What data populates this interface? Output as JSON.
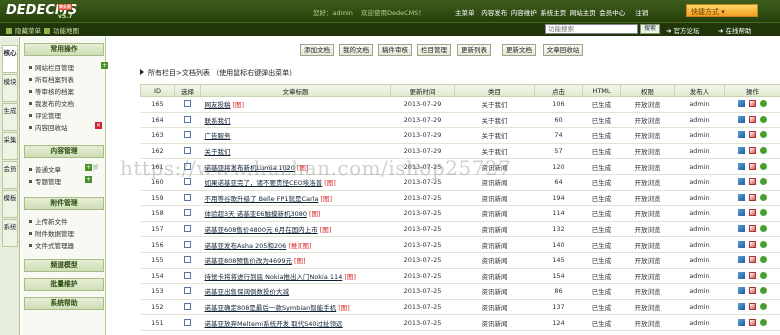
{
  "header": {
    "logo_text": "DEDECMS",
    "logo_badge": "商业版",
    "version": "v5.7",
    "welcome": [
      "您好：admin",
      "欢迎使用DedeCMS！"
    ],
    "nav": [
      "主菜单",
      "内容发布",
      "内容维护",
      "系统主页",
      "网站主页",
      "会员中心",
      "注销"
    ],
    "quick_button": "快捷方式"
  },
  "subbar": {
    "hide_menu": "隐藏菜单",
    "site_map": "功能地图",
    "search_placeholder": "功能搜索",
    "search_button": "搜索",
    "official_forum": "官方论坛",
    "help": "在线帮助"
  },
  "vtabs": [
    "核心",
    "模块",
    "生成",
    "采集",
    "会员",
    "模板",
    "系统"
  ],
  "sidebar": {
    "sections": [
      {
        "title": "常用操作",
        "items": [
          "网站栏目管理",
          "所有档案列表",
          "等审核的档案",
          "我发布的文档",
          "评论管理",
          "内容回收站"
        ]
      },
      {
        "title": "内容管理",
        "items": [
          "普通文章",
          "专题管理"
        ]
      },
      {
        "title": "附件管理",
        "items": [
          "上传新文件",
          "附件数据管理",
          "文件式管理器"
        ]
      },
      {
        "title": "频道模型",
        "items": []
      },
      {
        "title": "批量维护",
        "items": []
      },
      {
        "title": "系统帮助",
        "items": []
      }
    ],
    "plus_sign": "+",
    "mini_label": "部"
  },
  "toolbar": [
    "添加文档",
    "我的文档",
    "稿件审核",
    "栏目管理",
    "更新列表",
    "更新文档",
    "文章回收站"
  ],
  "breadcrumb": "所有栏目>文档列表  （使用鼠标右键弹出菜单）",
  "table": {
    "headers": [
      "ID",
      "选择",
      "文章标题",
      "更新时间",
      "类目",
      "点击",
      "HTML",
      "权限",
      "发布人",
      "操作"
    ],
    "rows": [
      {
        "id": "165",
        "title": "网友投稿",
        "flag": "[图]",
        "date": "2013-07-29",
        "category": "关于我们",
        "clicks": "106",
        "html": "已生成",
        "perm": "开放浏览",
        "author": "admin"
      },
      {
        "id": "164",
        "title": "联系我们",
        "flag": "",
        "date": "2013-07-29",
        "category": "关于我们",
        "clicks": "60",
        "html": "已生成",
        "perm": "开放浏览",
        "author": "admin"
      },
      {
        "id": "163",
        "title": "广告服务",
        "flag": "",
        "date": "2013-07-29",
        "category": "关于我们",
        "clicks": "74",
        "html": "已生成",
        "perm": "开放浏览",
        "author": "admin"
      },
      {
        "id": "162",
        "title": "关于我们",
        "flag": "",
        "date": "2013-07-29",
        "category": "关于我们",
        "clicks": "57",
        "html": "已生成",
        "perm": "开放浏览",
        "author": "admin"
      },
      {
        "id": "161",
        "title": "诺基亚将发布新机Lumia 1020",
        "flag": "[图]",
        "date": "2013-07-25",
        "category": "资讯新闻",
        "clicks": "120",
        "html": "已生成",
        "perm": "开放浏览",
        "author": "admin"
      },
      {
        "id": "160",
        "title": "如果诺基亚完了，诸不要责怪CEO埃洛普",
        "flag": "[图]",
        "date": "2013-07-25",
        "category": "资讯新闻",
        "clicks": "64",
        "html": "已生成",
        "perm": "开放浏览",
        "author": "admin"
      },
      {
        "id": "159",
        "title": "不用等谷歌升级了 Belle FP1就是Carla",
        "flag": "[图]",
        "date": "2013-07-25",
        "category": "资讯新闻",
        "clicks": "194",
        "html": "已生成",
        "perm": "开放浏览",
        "author": "admin"
      },
      {
        "id": "158",
        "title": "体验超3天 诺基亚E6触摸新机3080",
        "flag": "[图]",
        "date": "2013-07-25",
        "category": "资讯新闻",
        "clicks": "114",
        "html": "已生成",
        "perm": "开放浏览",
        "author": "admin"
      },
      {
        "id": "157",
        "title": "诺基亚608售价4800元 6月在国内上市",
        "flag": "[图]",
        "date": "2013-07-25",
        "category": "资讯新闻",
        "clicks": "132",
        "html": "已生成",
        "perm": "开放浏览",
        "author": "admin"
      },
      {
        "id": "156",
        "title": "诺基亚发布Asha 205和206",
        "flag": "[推][图]",
        "date": "2013-07-25",
        "category": "资讯新闻",
        "clicks": "140",
        "html": "已生成",
        "perm": "开放浏览",
        "author": "admin"
      },
      {
        "id": "155",
        "title": "诺基亚808预售价改为4699元",
        "flag": "[图]",
        "date": "2013-07-25",
        "category": "资讯新闻",
        "clicks": "145",
        "html": "已生成",
        "perm": "开放浏览",
        "author": "admin"
      },
      {
        "id": "154",
        "title": "持觉卡将将进行到底 Nokia推出入门Nokia 114",
        "flag": "[图]",
        "date": "2013-07-25",
        "category": "资讯新闻",
        "clicks": "154",
        "html": "已生成",
        "perm": "开放浏览",
        "author": "admin"
      },
      {
        "id": "153",
        "title": "诺基亚出售保阔倒数投价大减",
        "flag": "",
        "date": "2013-07-25",
        "category": "资讯新闻",
        "clicks": "86",
        "html": "已生成",
        "perm": "开放浏览",
        "author": "admin"
      },
      {
        "id": "152",
        "title": "诺基亚确定808是最后一款Symbian智能手机",
        "flag": "[图]",
        "date": "2013-07-25",
        "category": "资讯新闻",
        "clicks": "137",
        "html": "已生成",
        "perm": "开放浏览",
        "author": "admin"
      },
      {
        "id": "151",
        "title": "诺基亚放弃Meltemi系统开发 取代S40过扯领远",
        "flag": "",
        "date": "2013-07-25",
        "category": "资讯新闻",
        "clicks": "124",
        "html": "已生成",
        "perm": "开放浏览",
        "author": "admin"
      }
    ]
  },
  "watermark": "https://www.huzhan.com/ishop25727",
  "icons": {
    "edit": "edit-icon",
    "delete": "delete-icon",
    "view": "view-icon"
  }
}
